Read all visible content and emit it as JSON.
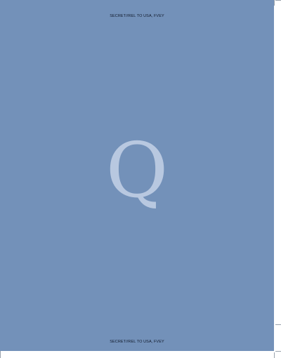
{
  "header": {
    "classification": "SECRET//REL TO USA, FVEY"
  },
  "cover": {
    "letter": "Q",
    "background_color": "#7391b9",
    "letter_color": "#b8c8e0"
  },
  "footer": {
    "classification": "SECRET//REL TO USA, FVEY"
  }
}
